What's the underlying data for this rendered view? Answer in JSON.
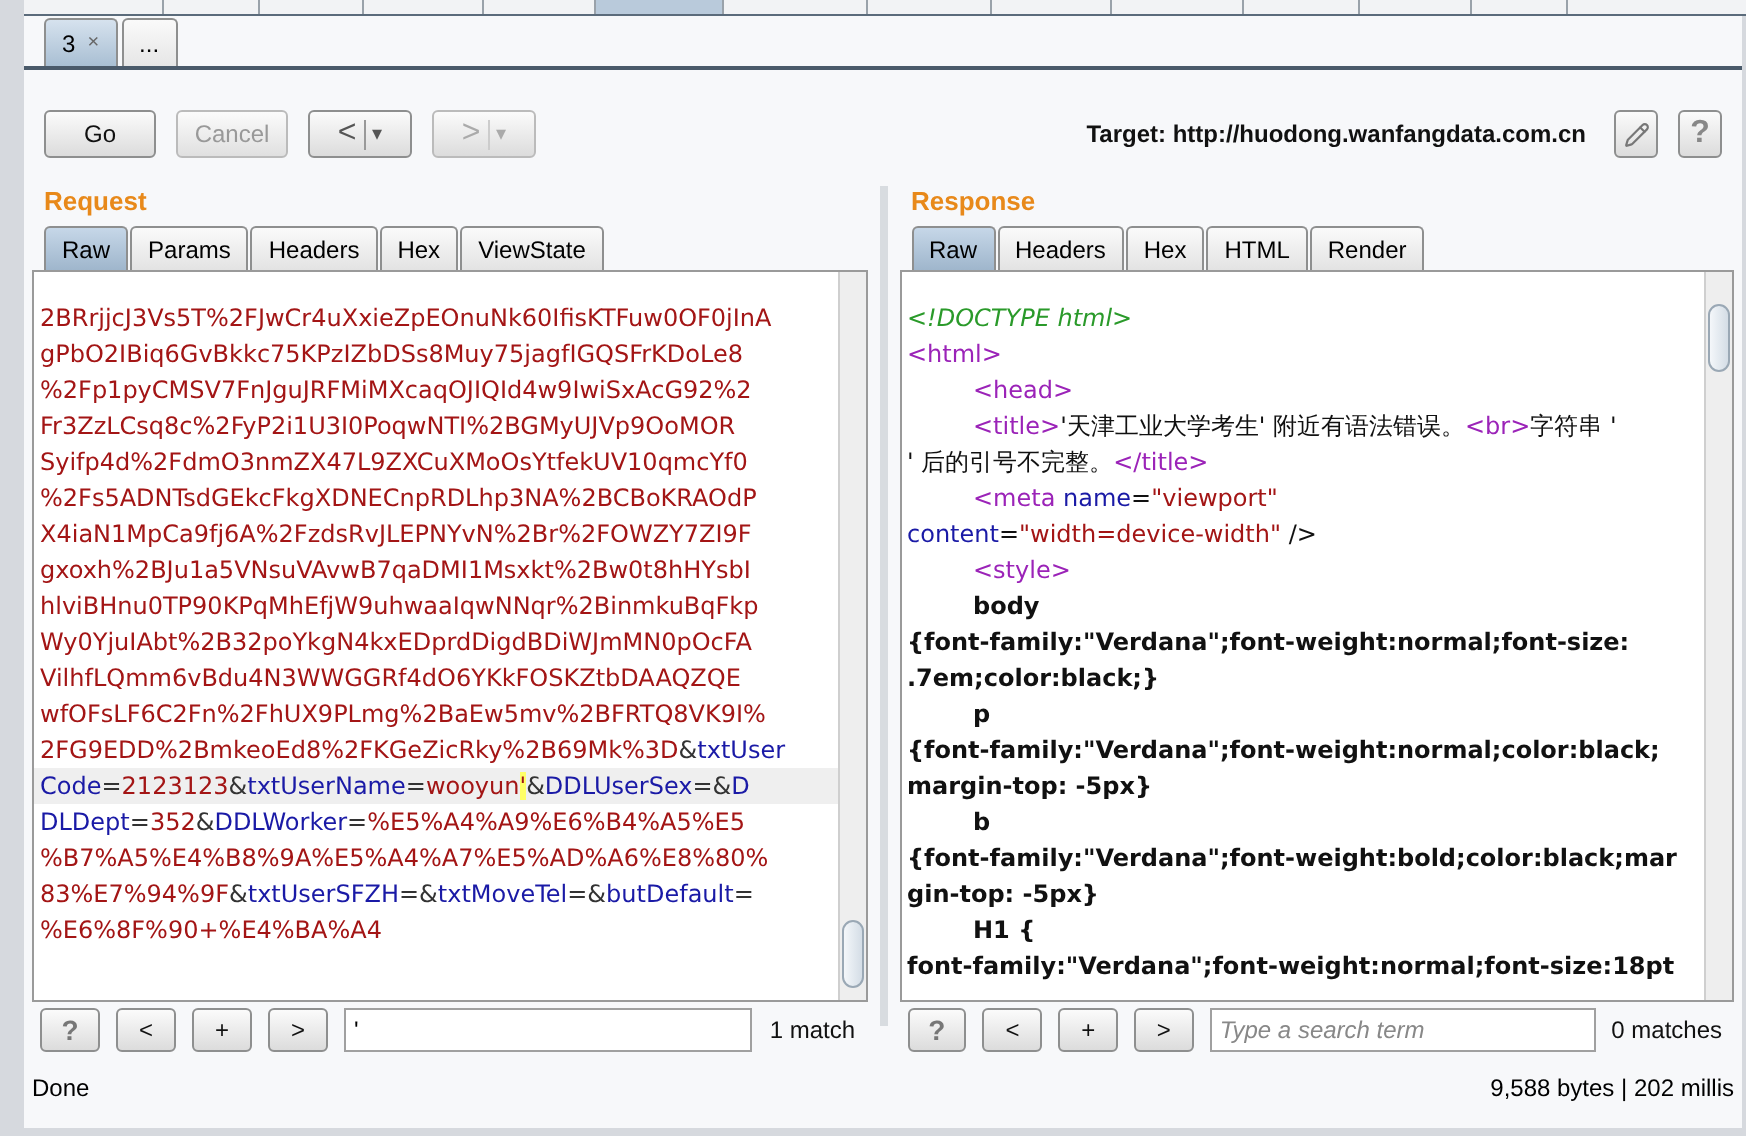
{
  "tool_tabs": [
    {
      "selected": false
    },
    {
      "selected": false
    },
    {
      "selected": false
    },
    {
      "selected": false
    },
    {
      "selected": false
    },
    {
      "selected": true
    },
    {
      "selected": false
    },
    {
      "selected": false
    },
    {
      "selected": false
    },
    {
      "selected": false
    },
    {
      "selected": false
    },
    {
      "selected": false
    },
    {
      "selected": false
    }
  ],
  "tabs": [
    {
      "label": "3",
      "close": "×",
      "selected": true
    },
    {
      "label": "...",
      "selected": false
    }
  ],
  "toolbar": {
    "go": {
      "label": "Go",
      "disabled": false
    },
    "cancel": {
      "label": "Cancel",
      "disabled": true
    },
    "back": {
      "label": "<",
      "caret": "▾",
      "disabled": false
    },
    "forward": {
      "label": ">",
      "caret": "▾",
      "disabled": true
    },
    "target": "Target: http://huodong.wanfangdata.com.cn",
    "help": "?"
  },
  "request": {
    "title": "Request",
    "tabs": [
      {
        "label": "Raw",
        "selected": true
      },
      {
        "label": "Params",
        "selected": false
      },
      {
        "label": "Headers",
        "selected": false
      },
      {
        "label": "Hex",
        "selected": false
      },
      {
        "label": "ViewState",
        "selected": false
      }
    ],
    "lines": [
      {
        "highlighted": false,
        "segments": [
          {
            "kind": "value",
            "text": "2BRrjjcJ3Vs5T%2FJwCr4uXxieZpEOnuNk60IfisKTFuw0OF0jInA"
          }
        ]
      },
      {
        "highlighted": false,
        "segments": [
          {
            "kind": "value",
            "text": "gPbO2IBiq6GvBkkc75KPzIZbDSs8Muy75jagfIGQSFrKDoLe8"
          }
        ]
      },
      {
        "highlighted": false,
        "segments": [
          {
            "kind": "value",
            "text": "%2Fp1pyCMSV7FnJguJRFMiMXcaqOJIQId4w9IwiSxAcG92%2"
          }
        ]
      },
      {
        "highlighted": false,
        "segments": [
          {
            "kind": "value",
            "text": "Fr3ZzLCsq8c%2FyP2i1U3I0PoqwNTI%2BGMyUJVp9OoMOR"
          }
        ]
      },
      {
        "highlighted": false,
        "segments": [
          {
            "kind": "value",
            "text": "Syifp4d%2FdmO3nmZX47L9ZXCuXMoOsYtfekUV10qmcYf0"
          }
        ]
      },
      {
        "highlighted": false,
        "segments": [
          {
            "kind": "value",
            "text": "%2Fs5ADNTsdGEkcFkgXDNECnpRDLhp3NA%2BCBoKRAOdP"
          }
        ]
      },
      {
        "highlighted": false,
        "segments": [
          {
            "kind": "value",
            "text": "X4iaN1MpCa9fj6A%2FzdsRvJLEPNYvN%2Br%2FOWZY7ZI9F"
          }
        ]
      },
      {
        "highlighted": false,
        "segments": [
          {
            "kind": "value",
            "text": "gxoxh%2BJu1a5VNsuVAvwB7qaDMI1Msxkt%2Bw0t8hHYsbI"
          }
        ]
      },
      {
        "highlighted": false,
        "segments": [
          {
            "kind": "value",
            "text": "hlviBHnu0TP90KPqMhEfjW9uhwaaIqwNNqr%2BinmkuBqFkp"
          }
        ]
      },
      {
        "highlighted": false,
        "segments": [
          {
            "kind": "value",
            "text": "Wy0YjuIAbt%2B32poYkgN4kxEDprdDigdBDiWJmMN0pOcFA"
          }
        ]
      },
      {
        "highlighted": false,
        "segments": [
          {
            "kind": "value",
            "text": "VilhfLQmm6vBdu4N3WWGGRf4dO6YKkFOSKZtbDAAQZQE"
          }
        ]
      },
      {
        "highlighted": false,
        "segments": [
          {
            "kind": "value",
            "text": "wfOFsLF6C2Fn%2FhUX9PLmg%2BaEw5mv%2BFRTQ8VK9I%"
          }
        ]
      },
      {
        "highlighted": false,
        "segments": [
          {
            "kind": "value",
            "text": "2FG9EDD%2BmkeoEd8%2FKGeZicRky%2B69Mk%3D"
          },
          {
            "kind": "sep",
            "text": "&"
          },
          {
            "kind": "param",
            "text": "txtUser"
          }
        ]
      },
      {
        "highlighted": true,
        "segments": [
          {
            "kind": "param",
            "text": "Code"
          },
          {
            "kind": "sep",
            "text": "="
          },
          {
            "kind": "value",
            "text": "2123123"
          },
          {
            "kind": "sep",
            "text": "&"
          },
          {
            "kind": "param",
            "text": "txtUserName"
          },
          {
            "kind": "sep",
            "text": "="
          },
          {
            "kind": "value",
            "text": "wooyun"
          },
          {
            "kind": "match",
            "text": "'"
          },
          {
            "kind": "sep",
            "text": "&"
          },
          {
            "kind": "param",
            "text": "DDLUserSex"
          },
          {
            "kind": "sep",
            "text": "=&"
          },
          {
            "kind": "param",
            "text": "D"
          }
        ]
      },
      {
        "highlighted": false,
        "segments": [
          {
            "kind": "param",
            "text": "DLDept"
          },
          {
            "kind": "sep",
            "text": "="
          },
          {
            "kind": "value",
            "text": "352"
          },
          {
            "kind": "sep",
            "text": "&"
          },
          {
            "kind": "param",
            "text": "DDLWorker"
          },
          {
            "kind": "sep",
            "text": "="
          },
          {
            "kind": "value",
            "text": "%E5%A4%A9%E6%B4%A5%E5"
          }
        ]
      },
      {
        "highlighted": false,
        "segments": [
          {
            "kind": "value",
            "text": "%B7%A5%E4%B8%9A%E5%A4%A7%E5%AD%A6%E8%80%"
          }
        ]
      },
      {
        "highlighted": false,
        "segments": [
          {
            "kind": "value",
            "text": "83%E7%94%9F"
          },
          {
            "kind": "sep",
            "text": "&"
          },
          {
            "kind": "param",
            "text": "txtUserSFZH"
          },
          {
            "kind": "sep",
            "text": "=&"
          },
          {
            "kind": "param",
            "text": "txtMoveTel"
          },
          {
            "kind": "sep",
            "text": "=&"
          },
          {
            "kind": "param",
            "text": "butDefault"
          },
          {
            "kind": "sep",
            "text": "="
          }
        ]
      },
      {
        "highlighted": false,
        "segments": [
          {
            "kind": "value",
            "text": "%E6%8F%90+%E4%BA%A4"
          }
        ]
      }
    ],
    "search": {
      "help": "?",
      "prev": "<",
      "add": "+",
      "next": ">",
      "value": "'",
      "matches": "1 match"
    }
  },
  "response": {
    "title": "Response",
    "tabs": [
      {
        "label": "Raw",
        "selected": true
      },
      {
        "label": "Headers",
        "selected": false
      },
      {
        "label": "Hex",
        "selected": false
      },
      {
        "label": "HTML",
        "selected": false
      },
      {
        "label": "Render",
        "selected": false
      }
    ],
    "lines": [
      {
        "indented": false,
        "segments": [
          {
            "kind": "comment",
            "text": "<!DOCTYPE html>"
          }
        ]
      },
      {
        "indented": false,
        "segments": [
          {
            "kind": "tag",
            "text": "<html>"
          }
        ]
      },
      {
        "indented": true,
        "segments": [
          {
            "kind": "tag",
            "text": "<head>"
          }
        ]
      },
      {
        "indented": true,
        "segments": [
          {
            "kind": "tag",
            "text": "<title>"
          },
          {
            "kind": "text",
            "text": "'天津工业大学考生' 附近有语法错误。"
          },
          {
            "kind": "tag",
            "text": "<br>"
          },
          {
            "kind": "text",
            "text": "字符串 '"
          }
        ]
      },
      {
        "indented": false,
        "segments": [
          {
            "kind": "text",
            "text": "' 后的引号不完整。"
          },
          {
            "kind": "tag",
            "text": "</title>"
          }
        ]
      },
      {
        "indented": true,
        "segments": [
          {
            "kind": "tag",
            "text": "<meta"
          },
          {
            "kind": "attr",
            "text": " name"
          },
          {
            "kind": "text",
            "text": "="
          },
          {
            "kind": "value",
            "text": "\"viewport\""
          }
        ]
      },
      {
        "indented": false,
        "segments": [
          {
            "kind": "attr",
            "text": "content"
          },
          {
            "kind": "text",
            "text": "="
          },
          {
            "kind": "value",
            "text": "\"width=device-width\""
          },
          {
            "kind": "text",
            "text": " />"
          }
        ]
      },
      {
        "indented": true,
        "segments": [
          {
            "kind": "tag",
            "text": "<style>"
          }
        ]
      },
      {
        "indented": true,
        "segments": [
          {
            "kind": "css",
            "text": "body"
          }
        ]
      },
      {
        "indented": false,
        "segments": [
          {
            "kind": "css",
            "text": "{font-family:\"Verdana\";font-weight:normal;font-size:"
          }
        ]
      },
      {
        "indented": false,
        "segments": [
          {
            "kind": "css",
            "text": ".7em;color:black;}"
          }
        ]
      },
      {
        "indented": true,
        "segments": [
          {
            "kind": "css",
            "text": "p"
          }
        ]
      },
      {
        "indented": false,
        "segments": [
          {
            "kind": "css",
            "text": "{font-family:\"Verdana\";font-weight:normal;color:black;"
          }
        ]
      },
      {
        "indented": false,
        "segments": [
          {
            "kind": "css",
            "text": "margin-top: -5px}"
          }
        ]
      },
      {
        "indented": true,
        "segments": [
          {
            "kind": "css",
            "text": "b"
          }
        ]
      },
      {
        "indented": false,
        "segments": [
          {
            "kind": "css",
            "text": "{font-family:\"Verdana\";font-weight:bold;color:black;mar"
          }
        ]
      },
      {
        "indented": false,
        "segments": [
          {
            "kind": "css",
            "text": "gin-top: -5px}"
          }
        ]
      },
      {
        "indented": true,
        "segments": [
          {
            "kind": "css",
            "text": "H1 {"
          }
        ]
      },
      {
        "indented": false,
        "segments": [
          {
            "kind": "css",
            "text": "font-family:\"Verdana\";font-weight:normal;font-size:18pt"
          }
        ]
      }
    ],
    "search": {
      "help": "?",
      "prev": "<",
      "add": "+",
      "next": ">",
      "placeholder": "Type a search term",
      "matches": "0 matches"
    }
  },
  "status_bar": {
    "left": "Done",
    "right": "9,588 bytes | 202 millis"
  }
}
